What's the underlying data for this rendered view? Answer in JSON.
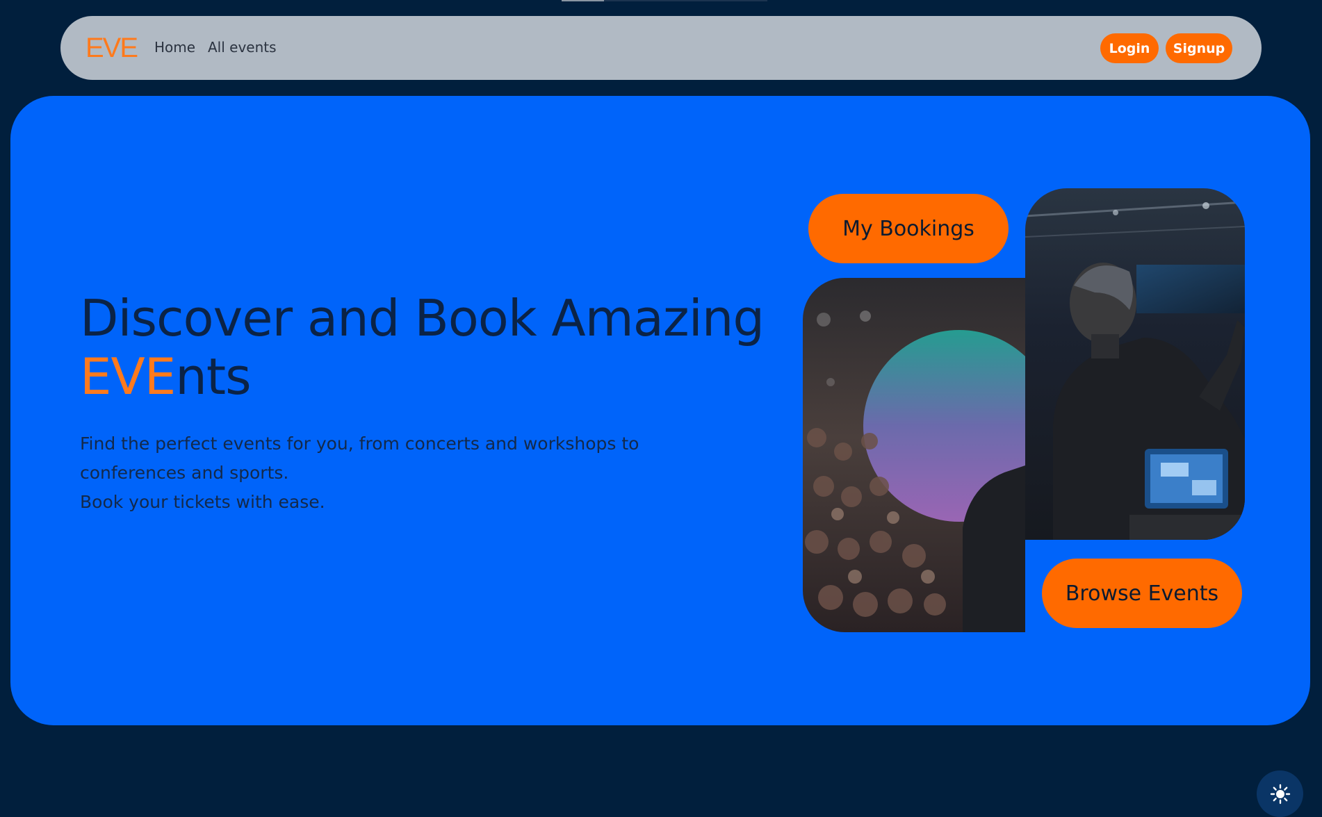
{
  "navbar": {
    "brand": "EVE",
    "links": [
      {
        "label": "Home"
      },
      {
        "label": "All events"
      }
    ],
    "login_label": "Login",
    "signup_label": "Signup"
  },
  "hero": {
    "headline_line1": "Discover and Book Amazing",
    "headline_accent": "EVE",
    "headline_rest": "nts",
    "subtext_line1": "Find the perfect events for you, from concerts and workshops to",
    "subtext_line2": "conferences and sports.",
    "subtext_line3": "Book your tickets with ease.",
    "bookings_label": "My Bookings",
    "browse_label": "Browse Events"
  },
  "theme_toggle": {
    "icon": "sun-icon"
  },
  "colors": {
    "background": "#011f3d",
    "navbar": "#b1bac4",
    "hero": "#0064fa",
    "accent": "#ff6a00",
    "brand": "#ff7a1c"
  }
}
